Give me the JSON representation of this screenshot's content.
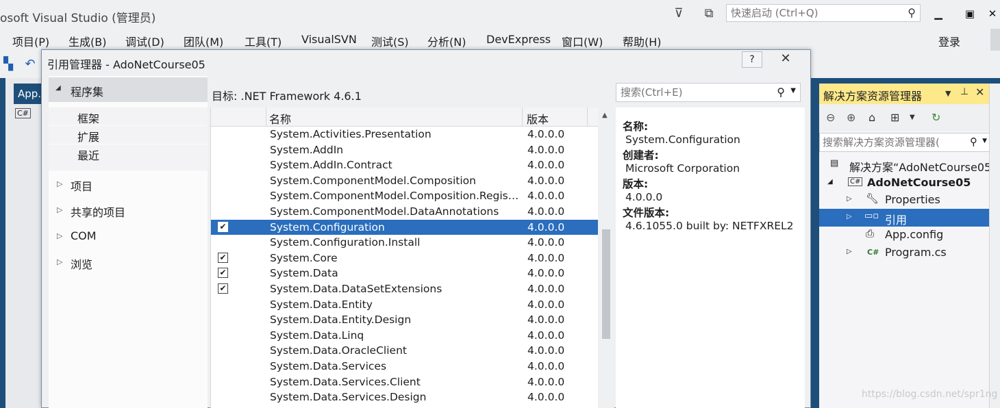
{
  "window": {
    "title": "osoft Visual Studio (管理员)",
    "quick_launch_placeholder": "快速启动 (Ctrl+Q)",
    "login": "登录"
  },
  "menu": [
    "项目(P)",
    "生成(B)",
    "调试(D)",
    "团队(M)",
    "工具(T)",
    "VisualSVN",
    "测试(S)",
    "分析(N)",
    "DevExpress",
    "窗口(W)",
    "帮助(H)"
  ],
  "editor": {
    "tab_label": "App.",
    "file_chip": "C#"
  },
  "dialog": {
    "title": "引用管理器 - AdoNetCourse05",
    "help": "?",
    "close": "✕",
    "nav": {
      "expanded": "程序集",
      "sub_items": [
        "框架",
        "扩展",
        "最近"
      ],
      "groups": [
        "项目",
        "共享的项目",
        "COM",
        "浏览"
      ]
    },
    "target": "目标: .NET Framework 4.6.1",
    "search_placeholder": "搜索(Ctrl+E)",
    "columns": {
      "name": "名称",
      "version": "版本"
    },
    "rows": [
      {
        "name": "System.Activities.Presentation",
        "version": "4.0.0.0",
        "checked": false
      },
      {
        "name": "System.AddIn",
        "version": "4.0.0.0",
        "checked": false
      },
      {
        "name": "System.AddIn.Contract",
        "version": "4.0.0.0",
        "checked": false
      },
      {
        "name": "System.ComponentModel.Composition",
        "version": "4.0.0.0",
        "checked": false
      },
      {
        "name": "System.ComponentModel.Composition.Regist...",
        "version": "4.0.0.0",
        "checked": false
      },
      {
        "name": "System.ComponentModel.DataAnnotations",
        "version": "4.0.0.0",
        "checked": false
      },
      {
        "name": "System.Configuration",
        "version": "4.0.0.0",
        "checked": true,
        "selected": true
      },
      {
        "name": "System.Configuration.Install",
        "version": "4.0.0.0",
        "checked": false
      },
      {
        "name": "System.Core",
        "version": "4.0.0.0",
        "checked": true
      },
      {
        "name": "System.Data",
        "version": "4.0.0.0",
        "checked": true
      },
      {
        "name": "System.Data.DataSetExtensions",
        "version": "4.0.0.0",
        "checked": true
      },
      {
        "name": "System.Data.Entity",
        "version": "4.0.0.0",
        "checked": false
      },
      {
        "name": "System.Data.Entity.Design",
        "version": "4.0.0.0",
        "checked": false
      },
      {
        "name": "System.Data.Linq",
        "version": "4.0.0.0",
        "checked": false
      },
      {
        "name": "System.Data.OracleClient",
        "version": "4.0.0.0",
        "checked": false
      },
      {
        "name": "System.Data.Services",
        "version": "4.0.0.0",
        "checked": false
      },
      {
        "name": "System.Data.Services.Client",
        "version": "4.0.0.0",
        "checked": false
      },
      {
        "name": "System.Data.Services.Design",
        "version": "4.0.0.0",
        "checked": false
      }
    ],
    "details": {
      "name_label": "名称:",
      "name": "System.Configuration",
      "creator_label": "创建者:",
      "creator": "Microsoft Corporation",
      "version_label": "版本:",
      "version": "4.0.0.0",
      "file_version_label": "文件版本:",
      "file_version": "4.6.1055.0 built by: NETFXREL2"
    }
  },
  "solution_explorer": {
    "title": "解决方案资源管理器",
    "search_placeholder": "搜索解决方案资源管理器(",
    "tree": [
      {
        "label": "解决方案“AdoNetCourse05",
        "icon": "solution-icon"
      },
      {
        "label": "AdoNetCourse05",
        "icon": "csharp-project-icon"
      },
      {
        "label": "Properties",
        "icon": "wrench-icon"
      },
      {
        "label": "引用",
        "icon": "references-icon"
      },
      {
        "label": "App.config",
        "icon": "config-file-icon"
      },
      {
        "label": "Program.cs",
        "icon": "csharp-file-icon"
      }
    ]
  },
  "watermark": "https://blog.csdn.net/spr1ng",
  "colors": {
    "accent": "#2a6ebd",
    "vs_blue": "#1e4f7a",
    "active_header": "#fde98a"
  }
}
